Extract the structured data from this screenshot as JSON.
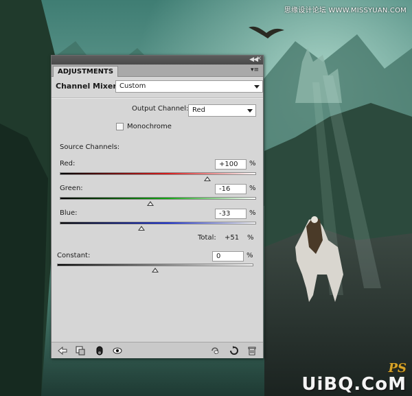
{
  "watermark": {
    "top_text": "思缘设计论坛 WWW.MISSYUAN.COM",
    "logo_ps": "PS",
    "logo_main": "UiBQ.CoM"
  },
  "panel": {
    "tab_label": "ADJUSTMENTS",
    "header_title": "Channel Mixer",
    "preset_value": "Custom",
    "output_channel_label": "Output Channel:",
    "output_channel_value": "Red",
    "monochrome_label": "Monochrome",
    "monochrome_checked": false,
    "source_channels_label": "Source Channels:",
    "channels": [
      {
        "name": "Red:",
        "value": "+100",
        "percent": 100,
        "color": "#d81c1c"
      },
      {
        "name": "Green:",
        "value": "-16",
        "percent": -16,
        "color": "#13a813"
      },
      {
        "name": "Blue:",
        "value": "-33",
        "percent": -33,
        "color": "#1a2fcf"
      }
    ],
    "pct_symbol": "%",
    "total_label": "Total:",
    "total_value": "+51",
    "constant_label": "Constant:",
    "constant_value": "0",
    "constant_percent": 0,
    "slider_range": [
      -200,
      200
    ],
    "bottom_icons": [
      "return-arrow-icon",
      "clip-layer-icon",
      "mask-toggle-icon",
      "eye-visibility-icon",
      "view-previous-icon",
      "reset-icon",
      "trash-icon"
    ]
  }
}
